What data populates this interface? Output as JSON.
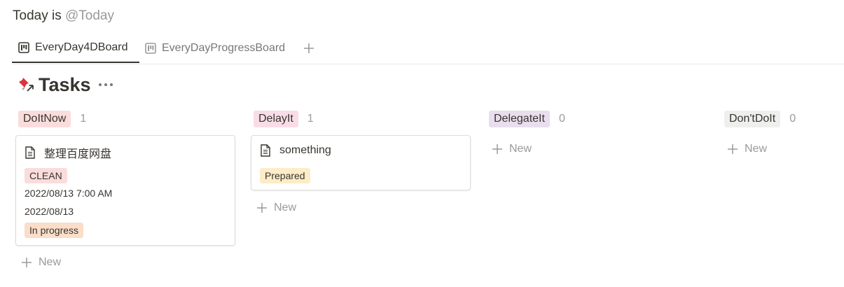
{
  "header": {
    "prefix": "Today is",
    "mention": "@Today"
  },
  "tabs": [
    {
      "label": "EveryDay4DBoard",
      "active": true
    },
    {
      "label": "EveryDayProgressBoard",
      "active": false
    }
  ],
  "page": {
    "icon": "pushpin-icon",
    "title": "Tasks"
  },
  "columns": [
    {
      "label": "DoItNow",
      "count": "1",
      "color": "#fbdcdc"
    },
    {
      "label": "DelayIt",
      "count": "1",
      "color": "#f8dde7"
    },
    {
      "label": "DelegateIt",
      "count": "0",
      "color": "#e8deee"
    },
    {
      "label": "Don'tDoIt",
      "count": "0",
      "color": "#efefee"
    }
  ],
  "cards": [
    {
      "title": "整理百度网盘",
      "tag": {
        "label": "CLEAN",
        "color": "#fbdcdc"
      },
      "datetime": "2022/08/13 7:00 AM",
      "date": "2022/08/13",
      "status": {
        "label": "In progress",
        "color": "#fadec9"
      }
    },
    {
      "title": "something",
      "status": {
        "label": "Prepared",
        "color": "#fdecc8"
      }
    }
  ],
  "new_label": "New"
}
